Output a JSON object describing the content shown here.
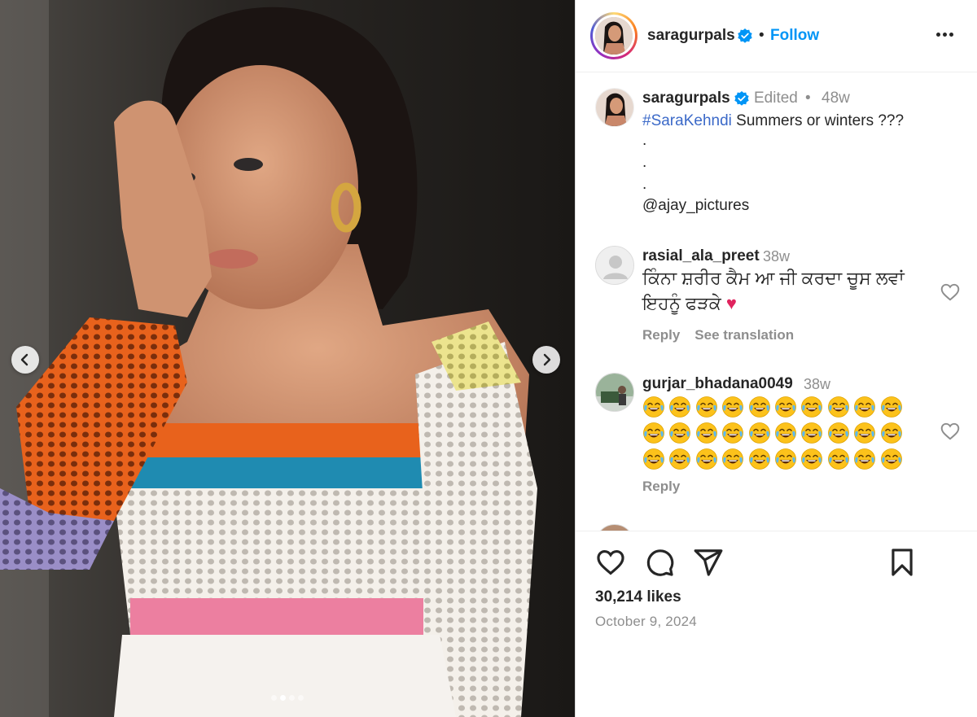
{
  "post": {
    "media_description_icon": "photo",
    "carousel": {
      "count": 4,
      "active_index": 1
    },
    "nav": {
      "prev_icon": "chevron-left-icon",
      "next_icon": "chevron-right-icon"
    }
  },
  "header": {
    "username": "saragurpals",
    "separator": "•",
    "follow_label": "Follow",
    "more_icon": "more-horizontal-icon"
  },
  "caption": {
    "username": "saragurpals",
    "edited": "Edited",
    "dot": "•",
    "time": "48w",
    "hashtag": "#SaraKehndi",
    "text": " Summers or winters ???",
    "dot_lines": [
      ".",
      ".",
      "."
    ],
    "mention": "@ajay_pictures"
  },
  "comments": [
    {
      "username": "rasial_ala_preet",
      "time": "38w",
      "text_line1": "ਕਿੰਨਾ ਸ਼ਰੀਰ ਕੈਮ ਆ ਜੀ ਕਰਦਾ ਚੂਸ ਲਵਾਂ",
      "text_line2": "ਇਹਨੂੰ ਫੜਕੇ",
      "heart_emoji": "❤️",
      "reply_label": "Reply",
      "translate_label": "See translation"
    },
    {
      "username": "gurjar_bhadana0049",
      "time": "38w",
      "emoji_count": 30,
      "emoji_name": "face-with-tears-of-joy",
      "reply_label": "Reply"
    }
  ],
  "footer": {
    "likes": "30,214 likes",
    "date": "October 9, 2024"
  },
  "colors": {
    "follow_blue": "#0095f6",
    "link_blue": "#3b69c8",
    "verified_blue": "#0095f6",
    "muted": "#8e8e8e",
    "heart_red": "#e0245e"
  }
}
